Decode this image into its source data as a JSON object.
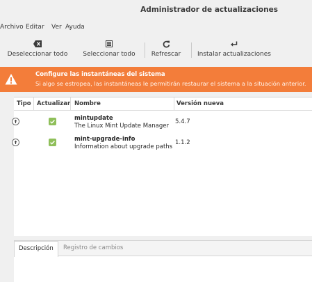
{
  "window": {
    "title": "Administrador de actualizaciones"
  },
  "menu": {
    "items": [
      "Archivo",
      "Editar",
      "Ver",
      "Ayuda"
    ]
  },
  "toolbar": {
    "deselect_label": "Deseleccionar todo",
    "select_label": "Seleccionar todo",
    "refresh_label": "Refrescar",
    "install_label": "Instalar actualizaciones"
  },
  "banner": {
    "title": "Configure las instantáneas del sistema",
    "text": "Si algo se estropea, las instantáneas le permitirán restaurar el sistema a la situación anterior.",
    "color": "#f37d3a"
  },
  "list": {
    "columns": [
      "Tipo",
      "Actualizar",
      "Nombre",
      "Versión nueva"
    ],
    "rows": [
      {
        "name": "mintupdate",
        "description": "The Linux Mint Update Manager",
        "version": "5.4.7",
        "checked": true
      },
      {
        "name": "mint-upgrade-info",
        "description": "Information about upgrade paths",
        "version": "1.1.2",
        "checked": true
      }
    ]
  },
  "handle": ".....",
  "tabs": {
    "description": "Descripción",
    "changelog": "Registro de cambios"
  },
  "colors": {
    "accent": "#8fbf5a"
  }
}
